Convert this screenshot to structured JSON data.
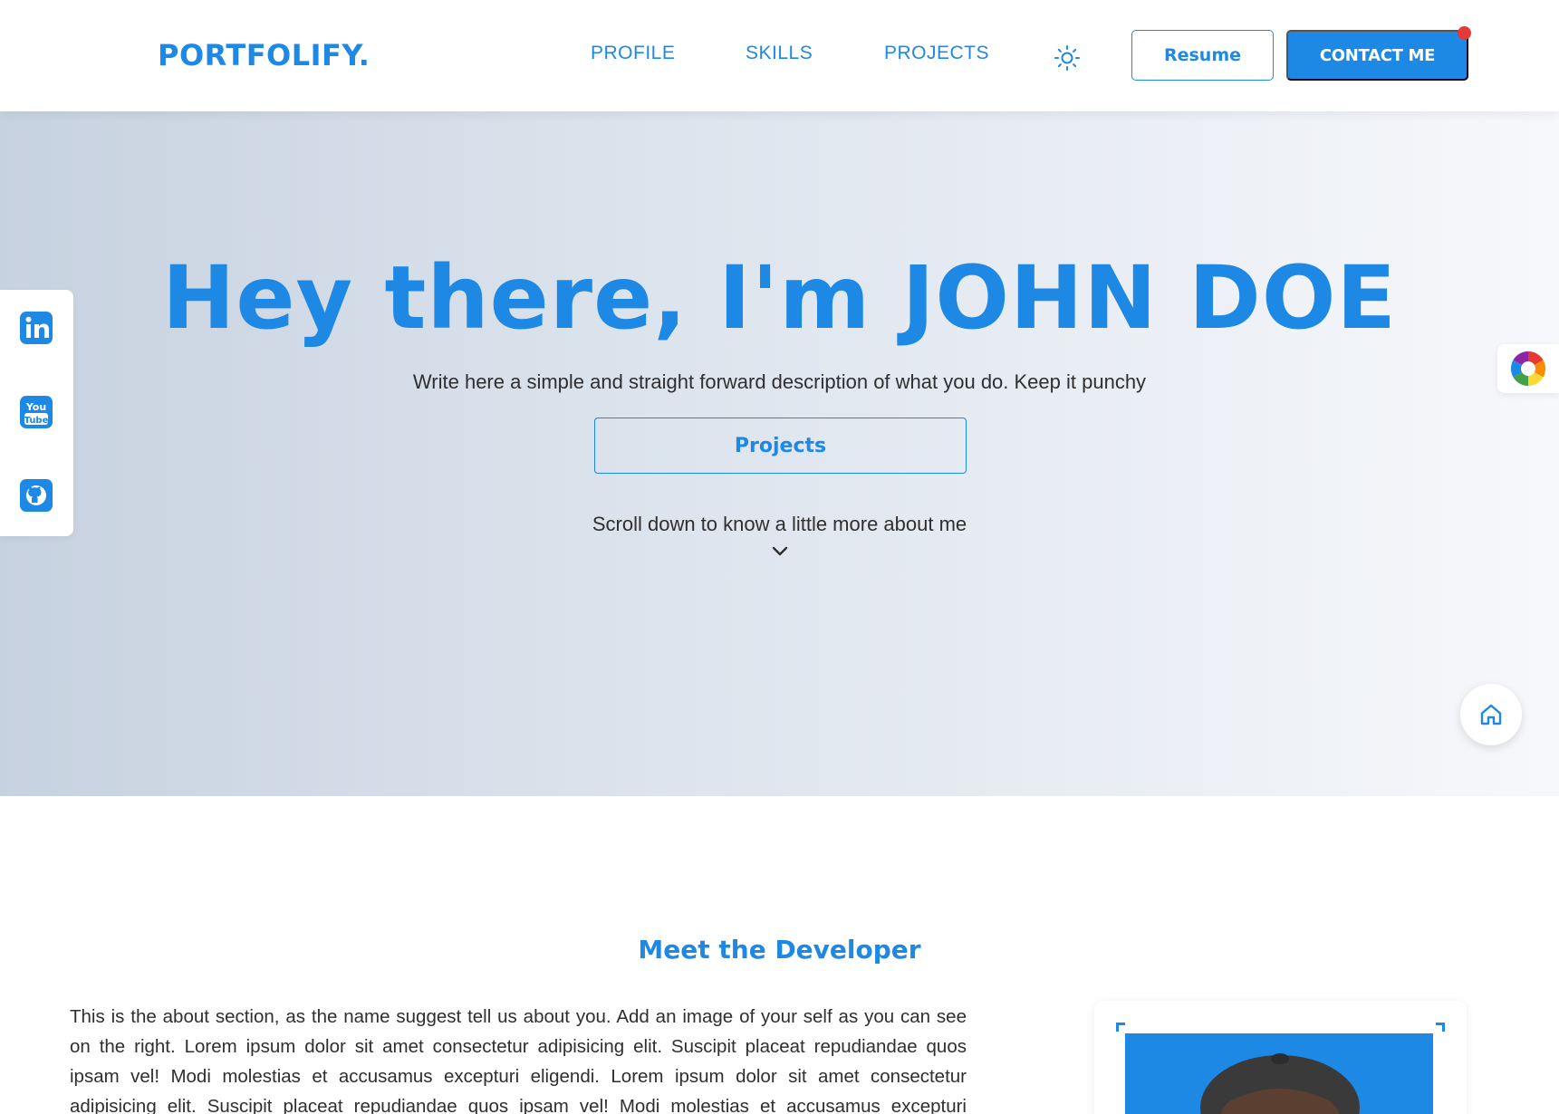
{
  "header": {
    "logo": "PORTFOLIFY.",
    "nav": {
      "profile": "PROFILE",
      "skills": "SKILLS",
      "projects": "PROJECTS"
    },
    "resume_label": "Resume",
    "contact_label": "CONTACT ME"
  },
  "hero": {
    "title": "Hey there, I'm JOHN DOE",
    "description": "Write here a simple and straight forward description of what you do. Keep it punchy",
    "projects_button": "Projects",
    "scroll_hint": "Scroll down to know a little more about me"
  },
  "social": {
    "icons": [
      "linkedin-icon",
      "youtube-icon",
      "github-icon"
    ],
    "youtube_top": "You",
    "youtube_bottom": "Tube"
  },
  "about": {
    "heading": "Meet the Developer",
    "text": "This is the about section, as the name suggest tell us about you. Add an image of your self as you can see on the right. Lorem ipsum dolor sit amet consectetur adipisicing elit. Suscipit placeat repudiandae quos ipsam vel! Modi molestias et accusamus excepturi eligendi. Lorem ipsum dolor sit amet consectetur adipisicing elit. Suscipit placeat repudiandae quos ipsam vel! Modi molestias et accusamus excepturi eligendi. Lorem ipsum"
  },
  "colors": {
    "accent": "#1e88e5",
    "notification": "#e53935",
    "hero_gradient_start": "#c7d2e0",
    "hero_gradient_end": "#f7f8fb"
  }
}
